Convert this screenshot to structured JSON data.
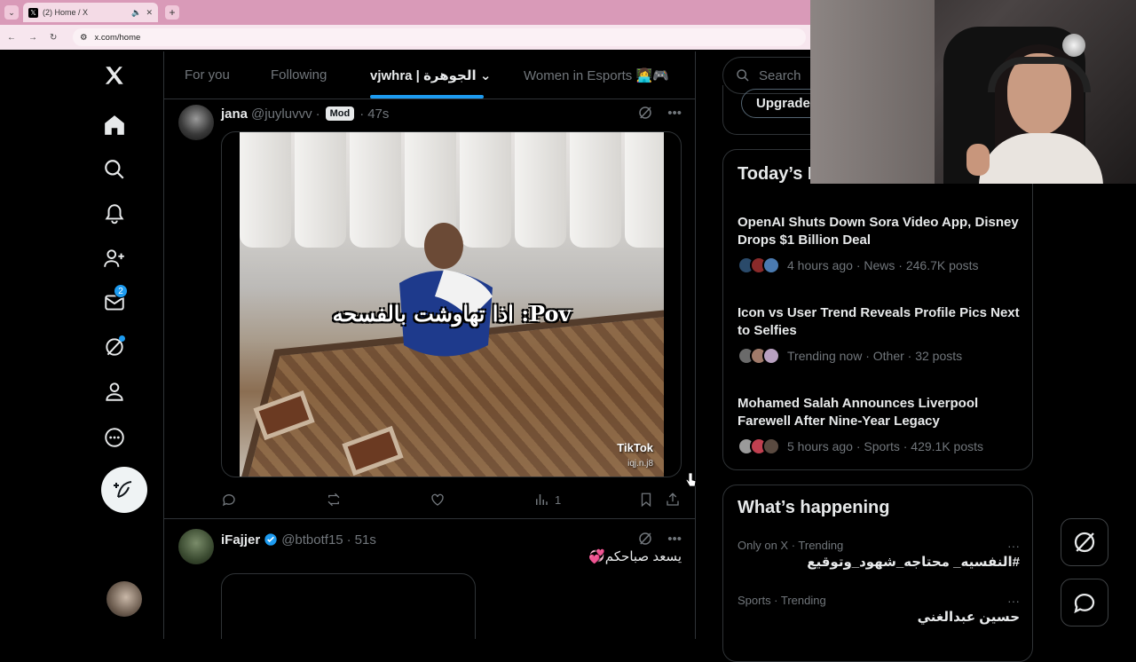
{
  "browser": {
    "tab_title": "(2) Home / X",
    "url": "x.com/home",
    "tab_menu_icon": "chevron-down-icon",
    "new_tab_icon": "plus-icon"
  },
  "timeline_tabs": [
    {
      "label": "For you"
    },
    {
      "label": "Following"
    },
    {
      "label": "vjwhra | الجوهرة"
    },
    {
      "label": "Women in Esports 👩‍💻🎮"
    }
  ],
  "nav": {
    "messages_badge": "2"
  },
  "posts": [
    {
      "name": "jana",
      "handle": "@juyluvvv",
      "sep": "·",
      "mod_label": "Mod",
      "time": "47s",
      "video_overlay": "اذا تهاوشت بالفسحه :Pov",
      "video_watermark": "TikTok",
      "video_watermark_sub": "iqj.n.j8",
      "views": "1"
    },
    {
      "name": "iFajjer",
      "handle": "@btbotf15",
      "sep": "·",
      "time": "51s",
      "text": "يسعد صباحكم💞"
    }
  ],
  "sidebar": {
    "search_placeholder": "Search",
    "upgrade_label": "Upgrade",
    "news_title": "Today’s News",
    "news": [
      {
        "headline": "OpenAI Shuts Down Sora Video App, Disney Drops $1 Billion Deal",
        "meta": "4 hours ago · News · 246.7K posts"
      },
      {
        "headline": "Icon vs User Trend Reveals Profile Pics Next to Selfies",
        "meta": "Trending now · Other · 32 posts"
      },
      {
        "headline": "Mohamed Salah Announces Liverpool Farewell After Nine-Year Legacy",
        "meta": "5 hours ago · Sports · 429.1K posts"
      }
    ],
    "happening_title": "What’s happening",
    "trends": [
      {
        "meta": "Only on X · Trending",
        "title": "#النفسيه_ محتاجه_شهود_وتوقيع"
      },
      {
        "meta": "Sports · Trending",
        "title": "حسين عبدالغني"
      }
    ],
    "more_glyph": "···"
  },
  "colors": {
    "accent": "#1d9bf0",
    "border": "#2f3336",
    "muted": "#71767b",
    "text": "#e7e9ea"
  }
}
